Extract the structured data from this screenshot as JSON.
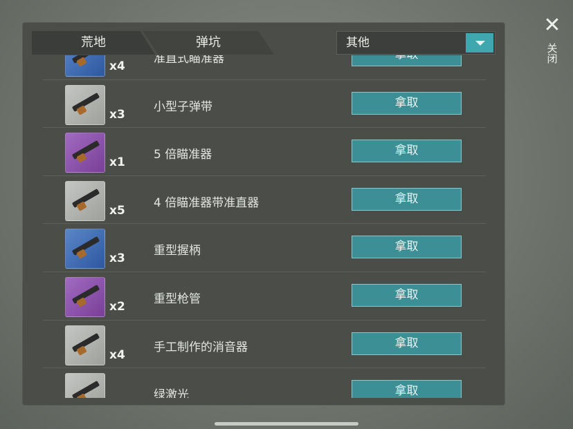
{
  "tabs": [
    {
      "label": "荒地"
    },
    {
      "label": "弹坑"
    }
  ],
  "filter": {
    "selected": "其他"
  },
  "close": {
    "label": "关闭"
  },
  "items": [
    {
      "name": "准直式瞄准器",
      "qty": "x4",
      "rarity": "blue",
      "action": "拿取"
    },
    {
      "name": "小型子弹带",
      "qty": "x3",
      "rarity": "gray",
      "action": "拿取"
    },
    {
      "name": "5 倍瞄准器",
      "qty": "x1",
      "rarity": "purple",
      "action": "拿取"
    },
    {
      "name": "4 倍瞄准器带准直器",
      "qty": "x5",
      "rarity": "gray",
      "action": "拿取"
    },
    {
      "name": "重型握柄",
      "qty": "x3",
      "rarity": "blue",
      "action": "拿取"
    },
    {
      "name": "重型枪管",
      "qty": "x2",
      "rarity": "purple",
      "action": "拿取"
    },
    {
      "name": "手工制作的消音器",
      "qty": "x4",
      "rarity": "gray",
      "action": "拿取"
    },
    {
      "name": "绿激光",
      "qty": "",
      "rarity": "gray",
      "action": "拿取"
    }
  ],
  "colors": {
    "accent": "#3fa7ad",
    "button": "#3b8f95",
    "panel": "#4a4d48"
  }
}
